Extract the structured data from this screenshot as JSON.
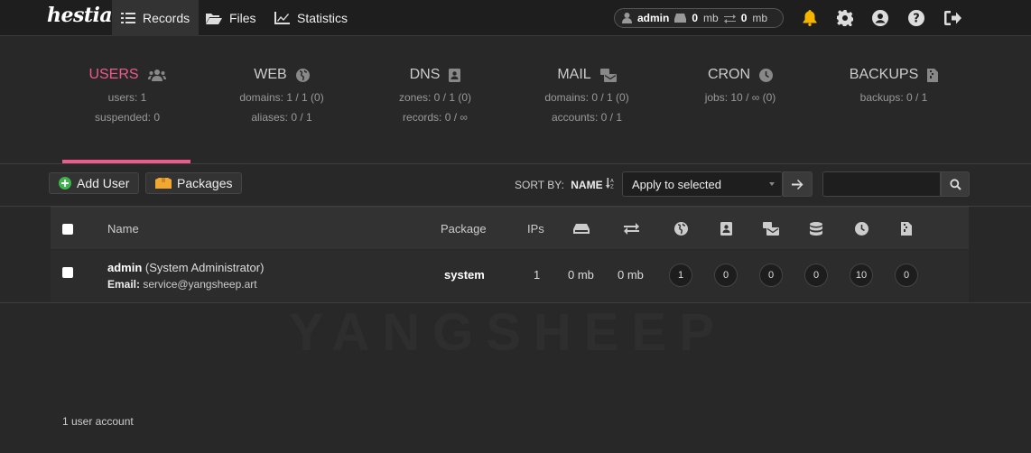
{
  "app": {
    "logo_text": "hestia"
  },
  "nav": {
    "records": "Records",
    "files": "Files",
    "statistics": "Statistics"
  },
  "user_pill": {
    "username": "admin",
    "disk": "0",
    "disk_unit": "mb",
    "bandwidth": "0",
    "bandwidth_unit": "mb"
  },
  "stats": [
    {
      "title": "USERS",
      "line1": "users: 1",
      "line2": "suspended: 0"
    },
    {
      "title": "WEB",
      "line1": "domains: 1 / 1 (0)",
      "line2": "aliases: 0 / 1"
    },
    {
      "title": "DNS",
      "line1": "zones: 0 / 1 (0)",
      "line2": "records: 0 / ∞"
    },
    {
      "title": "MAIL",
      "line1": "domains: 0 / 1 (0)",
      "line2": "accounts: 0 / 1"
    },
    {
      "title": "CRON",
      "line1": "jobs: 10 / ∞ (0)",
      "line2": ""
    },
    {
      "title": "BACKUPS",
      "line1": "backups: 0 / 1",
      "line2": ""
    }
  ],
  "toolbar": {
    "add_user": "Add User",
    "packages": "Packages",
    "sort_label": "SORT BY:",
    "sort_value": "NAME",
    "bulk_action": "Apply to selected",
    "search_placeholder": ""
  },
  "table": {
    "headers": {
      "name": "Name",
      "package": "Package",
      "ips": "IPs"
    },
    "rows": [
      {
        "username": "admin",
        "fullname": "(System Administrator)",
        "email_label": "Email:",
        "email": "service@yangsheep.art",
        "package": "system",
        "ips": "1",
        "disk": "0 mb",
        "bandwidth": "0 mb",
        "web": "1",
        "dns": "0",
        "mail": "0",
        "db": "0",
        "cron": "10",
        "backups": "0"
      }
    ]
  },
  "footer": {
    "count": "1 user account"
  },
  "watermark": "YANGSHEEP",
  "colors": {
    "accent": "#ee5b8b",
    "background": "#282828",
    "topbar": "#1e1e1e",
    "notify": "#f4b400"
  }
}
